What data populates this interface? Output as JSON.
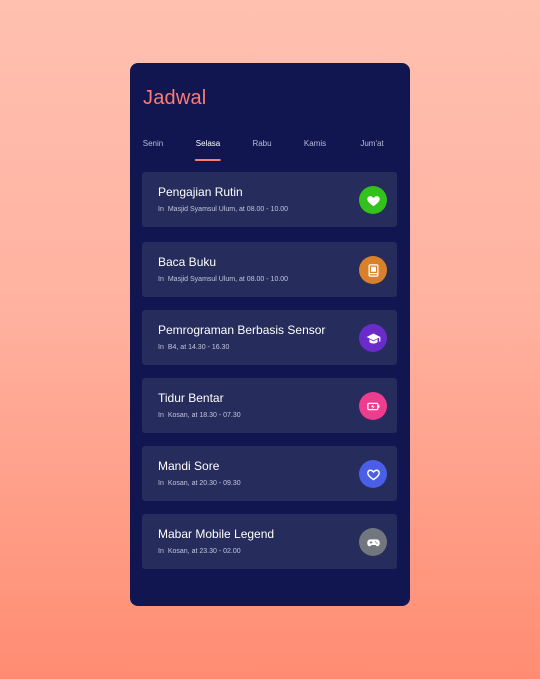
{
  "header": {
    "title": "Jadwal"
  },
  "tabs": [
    {
      "label": "Senin",
      "active": false
    },
    {
      "label": "Selasa",
      "active": true
    },
    {
      "label": "Rabu",
      "active": false
    },
    {
      "label": "Kamis",
      "active": false
    },
    {
      "label": "Jum'at",
      "active": false
    }
  ],
  "schedule": [
    {
      "title": "Pengajian Rutin",
      "prefix": "In",
      "detail": "Masjid Syamsul Ulum, at 08.00 - 10.00",
      "icon": "heart-icon",
      "color": "#33c21c"
    },
    {
      "title": "Baca Buku",
      "prefix": "In",
      "detail": "Masjid Syamsul Ulum, at 08.00 - 10.00",
      "icon": "book-icon",
      "color": "#d9802a"
    },
    {
      "title": "Pemrograman Berbasis Sensor",
      "prefix": "In",
      "detail": "B4, at 14.30 - 16.30",
      "icon": "graduation-cap-icon",
      "color": "#6a2cc9"
    },
    {
      "title": "Tidur Bentar",
      "prefix": "In",
      "detail": "Kosan, at 18.30 - 07.30",
      "icon": "battery-charging-icon",
      "color": "#ee3c8f"
    },
    {
      "title": "Mandi Sore",
      "prefix": "In",
      "detail": "Kosan, at 20.30 - 09.30",
      "icon": "heart-outline-icon",
      "color": "#4a5fe6"
    },
    {
      "title": "Mabar Mobile Legend",
      "prefix": "In",
      "detail": "Kosan, at 23.30 - 02.00",
      "icon": "gamepad-icon",
      "color": "#72777f"
    }
  ]
}
